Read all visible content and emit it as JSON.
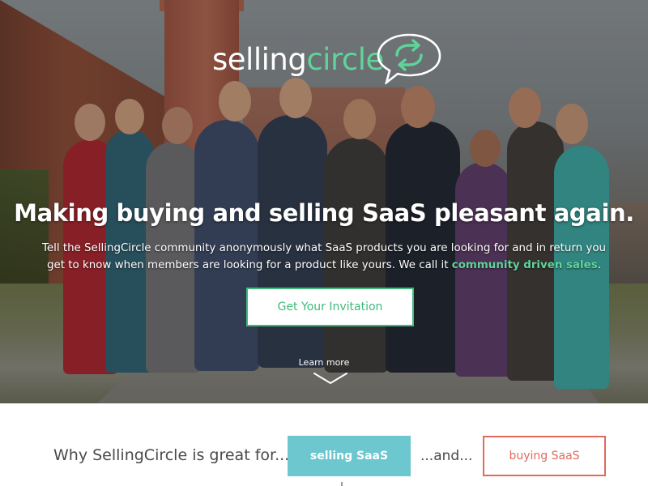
{
  "logo": {
    "part1": "selling",
    "part2": "circle",
    "icon": "speech-bubble-cycle-arrows-icon"
  },
  "hero": {
    "headline": "Making buying and selling SaaS pleasant again.",
    "subtext_before": "Tell the SellingCircle community anonymously what SaaS products you are looking for and in return you get to know when members are looking for a product like yours. We call it ",
    "subtext_highlight": "community driven sales",
    "subtext_after": ".",
    "cta_label": "Get Your Invitation",
    "learn_more": "Learn more",
    "learn_more_icon": "chevron-down-icon"
  },
  "why_section": {
    "lead": "Why SellingCircle is great for...",
    "selling_label": "selling SaaS",
    "and_label": "...and...",
    "buying_label": "buying SaaS"
  },
  "colors": {
    "brand_green": "#5fd49a",
    "cta_green": "#3fba7b",
    "selling_teal": "#6cc7cf",
    "buying_coral": "#e06a5c",
    "text_dark": "#4a4a4a"
  }
}
